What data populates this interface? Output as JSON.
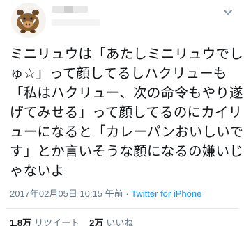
{
  "tweet": {
    "text": "ミニリュウは「あたしミニリュウでしゅ☆」って顔してるしハクリューも「私はハクリュー、次の命令もやり遂げてみせる」って顔してるのにカイリューになると「カレーパンおいしいです」とか言いそうな顔になるの嫌いじゃないよ",
    "timestamp": "2017年02月05日 10:15 午前",
    "separator": " · ",
    "source": "Twitter for iPhone"
  },
  "stats": {
    "retweets_count": "1.8万",
    "retweets_label": "リツイート",
    "likes_count": "2万",
    "likes_label": "いいね"
  },
  "icons": {
    "avatar": "boar-avatar-icon",
    "menu": "chevron-down-icon"
  },
  "colors": {
    "text": "#14171a",
    "muted": "#657786",
    "link": "#1b95e0",
    "divider": "#e1e8ed"
  }
}
